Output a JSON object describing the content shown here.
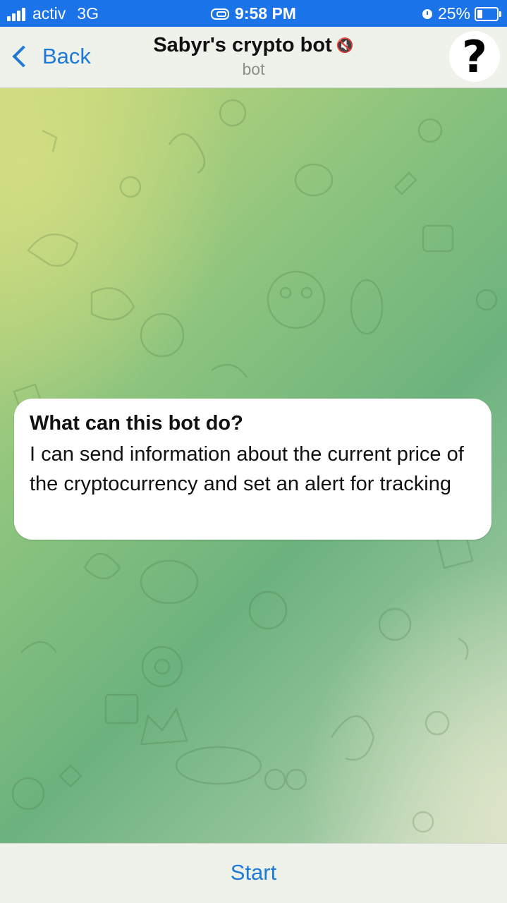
{
  "status_bar": {
    "carrier": "activ",
    "network": "3G",
    "time": "9:58 PM",
    "battery": "25%",
    "battery_level": 0.25,
    "icons": [
      "signal-icon",
      "link-icon",
      "alarm-icon",
      "battery-icon"
    ]
  },
  "header": {
    "back_label": "Back",
    "title": "Sabyr's crypto bot",
    "subtitle": "bot",
    "mute_icon": "🔇",
    "avatar_glyph": "?"
  },
  "info_card": {
    "title": "What can this bot do?",
    "text": "I can send information about the current price of the cryptocurrency and set an alert for tracking"
  },
  "bottom_bar": {
    "start_label": "Start"
  },
  "colors": {
    "status_bar": "#1a73e8",
    "accent": "#1e7ad6",
    "header_bg": "#eef2ea"
  }
}
